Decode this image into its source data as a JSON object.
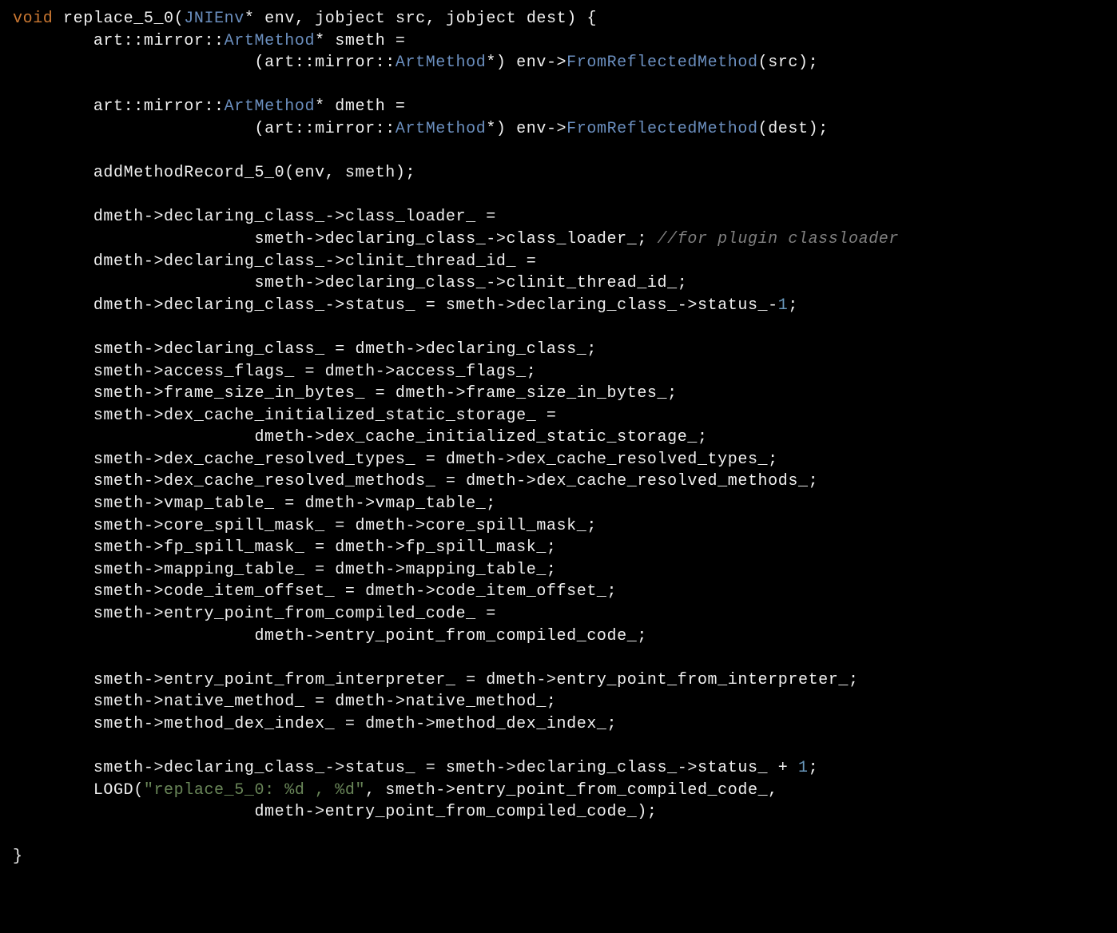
{
  "language": "cpp",
  "theme": "dark",
  "colors": {
    "background": "#000000",
    "foreground": "#f0f0f0",
    "keyword": "#cb7832",
    "type": "#6b8fbf",
    "number": "#6897bb",
    "comment": "#808080",
    "string": "#6a8759"
  },
  "tokens": {
    "kw_void": "void",
    "fn_name": "replace_5_0",
    "ty_JNIEnv": "JNIEnv",
    "ty_ArtMethod": "ArtMethod",
    "ty_FromReflectedMethod": "FromReflectedMethod",
    "id_env": "env",
    "id_jobject": "jobject",
    "id_src": "src",
    "id_dest": "dest",
    "ns_art_mirror": "art::mirror::",
    "id_smeth": "smeth",
    "id_dmeth": "dmeth",
    "call_addMethodRecord": "addMethodRecord_5_0(env, smeth);",
    "stmt_dclass_loader": "dmeth->declaring_class_->class_loader_ =",
    "stmt_sclass_loader": "smeth->declaring_class_->class_loader_;",
    "cm_plugin": "//for plugin classloader",
    "stmt_dclinit": "dmeth->declaring_class_->clinit_thread_id_ =",
    "stmt_sclinit": "smeth->declaring_class_->clinit_thread_id_;",
    "stmt_dstatus_pre": "dmeth->declaring_class_->status_ = smeth->declaring_class_->status_-",
    "num_1": "1",
    "semi": ";",
    "asg_decl_class": "smeth->declaring_class_ = dmeth->declaring_class_;",
    "asg_access_flags": "smeth->access_flags_ = dmeth->access_flags_;",
    "asg_frame_size": "smeth->frame_size_in_bytes_ = dmeth->frame_size_in_bytes_;",
    "asg_dcis_lhs": "smeth->dex_cache_initialized_static_storage_ =",
    "asg_dcis_rhs": "dmeth->dex_cache_initialized_static_storage_;",
    "asg_dcrt": "smeth->dex_cache_resolved_types_ = dmeth->dex_cache_resolved_types_;",
    "asg_dcrm": "smeth->dex_cache_resolved_methods_ = dmeth->dex_cache_resolved_methods_;",
    "asg_vmap": "smeth->vmap_table_ = dmeth->vmap_table_;",
    "asg_core_spill": "smeth->core_spill_mask_ = dmeth->core_spill_mask_;",
    "asg_fp_spill": "smeth->fp_spill_mask_ = dmeth->fp_spill_mask_;",
    "asg_mapping": "smeth->mapping_table_ = dmeth->mapping_table_;",
    "asg_code_item": "smeth->code_item_offset_ = dmeth->code_item_offset_;",
    "asg_epcc_lhs": "smeth->entry_point_from_compiled_code_ =",
    "asg_epcc_rhs": "dmeth->entry_point_from_compiled_code_;",
    "asg_ep_interp": "smeth->entry_point_from_interpreter_ = dmeth->entry_point_from_interpreter_;",
    "asg_native": "smeth->native_method_ = dmeth->native_method_;",
    "asg_mdi": "smeth->method_dex_index_ = dmeth->method_dex_index_;",
    "stmt_status_plus_pre": "smeth->declaring_class_->status_ = smeth->declaring_class_->status_ + ",
    "log_call_pre": "LOGD(",
    "log_str": "\"replace_5_0: %d , %d\"",
    "log_arg1": ", smeth->entry_point_from_compiled_code_,",
    "log_arg2": "dmeth->entry_point_from_compiled_code_);",
    "brace_close": "}"
  }
}
